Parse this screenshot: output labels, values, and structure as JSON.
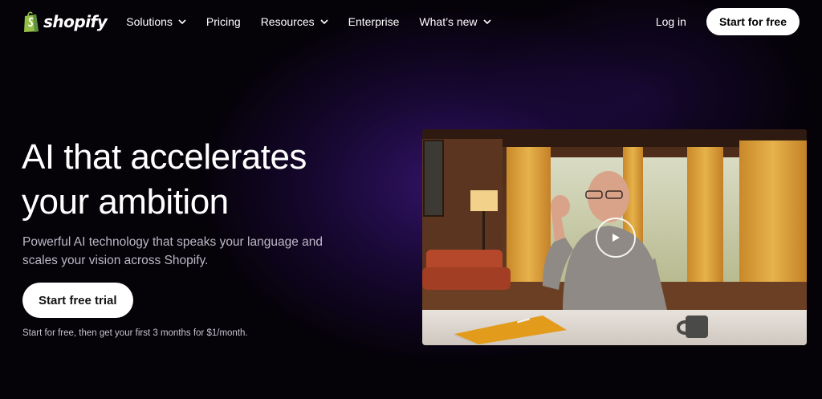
{
  "nav": {
    "logo_text": "shopify",
    "items": [
      {
        "label": "Solutions",
        "has_dropdown": true
      },
      {
        "label": "Pricing",
        "has_dropdown": false
      },
      {
        "label": "Resources",
        "has_dropdown": true
      },
      {
        "label": "Enterprise",
        "has_dropdown": false
      },
      {
        "label": "What’s new",
        "has_dropdown": true
      }
    ],
    "login": "Log in",
    "cta": "Start for free"
  },
  "hero": {
    "title_line1": "AI that accelerates",
    "title_line2": "your ambition",
    "subtitle": "Powerful AI technology that speaks your language and scales your vision across Shopify.",
    "cta": "Start free trial",
    "note": "Start for free, then get your first 3 months for $1/month."
  },
  "video": {
    "icon": "play-icon"
  },
  "colors": {
    "brand_green": "#95BF47",
    "background": "#000000",
    "accent_purple": "#3A1678"
  }
}
